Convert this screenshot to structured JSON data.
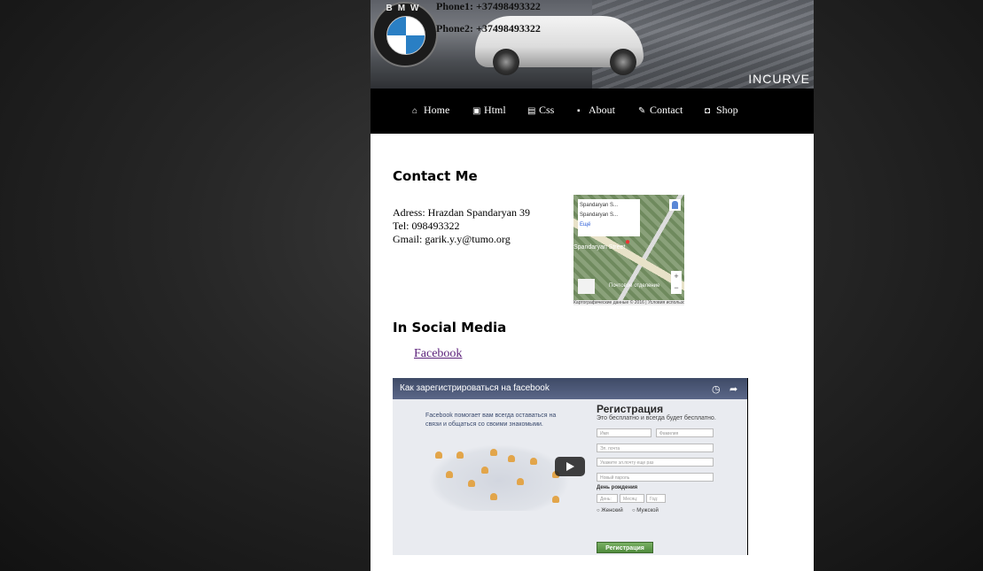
{
  "header": {
    "logo_text": "BMW",
    "phone1": "Phone1: +37498493322",
    "phone2": "Phone2: +37498493322",
    "banner_brand": "INCURVE"
  },
  "nav": {
    "items": [
      {
        "label": "Home",
        "icon": "home-icon"
      },
      {
        "label": "Html",
        "icon": "html5-icon"
      },
      {
        "label": "Css",
        "icon": "css3-icon"
      },
      {
        "label": "About",
        "icon": "contact-card-icon"
      },
      {
        "label": "Contact",
        "icon": "wrench-icon"
      },
      {
        "label": "Shop",
        "icon": "shopping-bag-icon"
      }
    ]
  },
  "contact": {
    "heading": "Contact Me",
    "address": "Adress: Hrazdan Spandaryan 39",
    "tel": "Tel: 098493322",
    "gmail": "Gmail: garik.y.y@tumo.org"
  },
  "map": {
    "popup_line1": "Spandaryan S...",
    "popup_line2": "Spandaryan S...",
    "popup_link": "Ещё",
    "street_label": "Spandaryan Street",
    "nearby_label": "Почтовое отделение",
    "footer_text": "Картографические данные © 2016 | Условия использования"
  },
  "social": {
    "heading": "In Social Media",
    "facebook_link": "Facebook"
  },
  "video": {
    "title": "Как зарегистрироваться на facebook",
    "blurb": "Facebook помогает вам всегда оставаться на связи и общаться со своими знакомыми.",
    "reg_title": "Регистрация",
    "reg_subtitle": "Это бесплатно и всегда будет бесплатно.",
    "field_first_name": "Имя",
    "field_last_name": "Фамилия",
    "field_email": "Эл. почта",
    "field_email_repeat": "Укажите эл.почту еще раз",
    "field_password": "Новый пароль",
    "birthday_label": "День рождения",
    "day_label": "День:",
    "month_label": "Месяц:",
    "year_label": "Год:",
    "female_label": "Женский",
    "male_label": "Мужской",
    "register_button": "Регистрация"
  },
  "colors": {
    "background": "#1e1e1e",
    "nav_background": "#000000",
    "link_visited": "#5a1f7a"
  }
}
